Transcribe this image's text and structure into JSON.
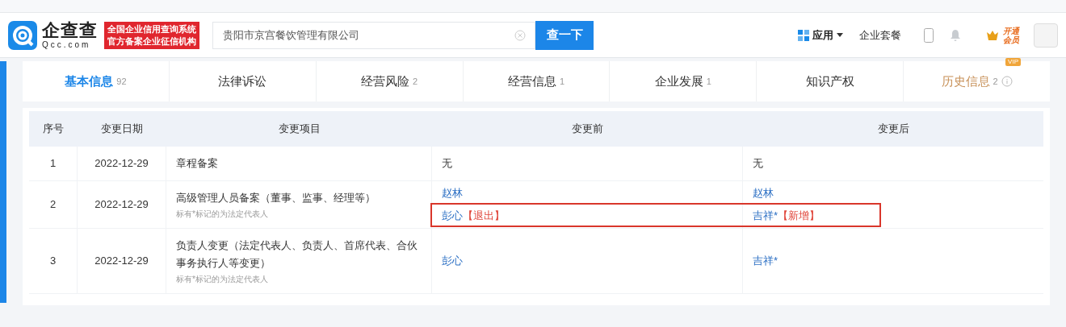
{
  "header": {
    "logo_name": "企查查",
    "logo_domain": "Qcc.com",
    "badge_lines": [
      "全国企业信用查询系统",
      "官方备案企业征信机构"
    ],
    "search": {
      "value": "贵阳市京宫餐饮管理有限公司"
    },
    "search_button": "查一下",
    "apps_menu": "应用",
    "package_link": "企业套餐",
    "vip_lines": [
      "开通",
      "会员"
    ]
  },
  "tabs": [
    {
      "label": "基本信息",
      "count": "92",
      "selected": true
    },
    {
      "label": "法律诉讼",
      "selected": false
    },
    {
      "label": "经营风险",
      "count": "2",
      "selected": false
    },
    {
      "label": "经营信息",
      "count": "1",
      "selected": false
    },
    {
      "label": "企业发展",
      "count": "1",
      "selected": false
    },
    {
      "label": "知识产权",
      "selected": false
    },
    {
      "label": "历史信息",
      "count": "2",
      "badge": "VIP",
      "selected": false
    }
  ],
  "table": {
    "columns": [
      "序号",
      "变更日期",
      "变更项目",
      "变更前",
      "变更后"
    ],
    "rows": [
      {
        "index": "1",
        "date": "2022-12-29",
        "item": "章程备案",
        "before": [
          {
            "name": "无",
            "kind": "plain"
          }
        ],
        "after": [
          {
            "name": "无",
            "kind": "plain"
          }
        ],
        "highlighted": false
      },
      {
        "index": "2",
        "date": "2022-12-29",
        "item": "高级管理人员备案（董事、监事、经理等）",
        "note": "标有*标记的为法定代表人",
        "before": [
          {
            "name": "赵林",
            "kind": "link"
          },
          {
            "name": "彭心",
            "tag": "【退出】",
            "kind": "link"
          }
        ],
        "after": [
          {
            "name": "赵林",
            "kind": "link"
          },
          {
            "name": "吉祥*",
            "tag": "【新增】",
            "kind": "link"
          }
        ],
        "highlighted": true
      },
      {
        "index": "3",
        "date": "2022-12-29",
        "item": "负责人变更（法定代表人、负责人、首席代表、合伙事务执行人等变更）",
        "note": "标有*标记的为法定代表人",
        "before": [
          {
            "name": "彭心",
            "kind": "link"
          }
        ],
        "after": [
          {
            "name": "吉祥*",
            "kind": "link"
          }
        ],
        "highlighted": false
      }
    ]
  }
}
